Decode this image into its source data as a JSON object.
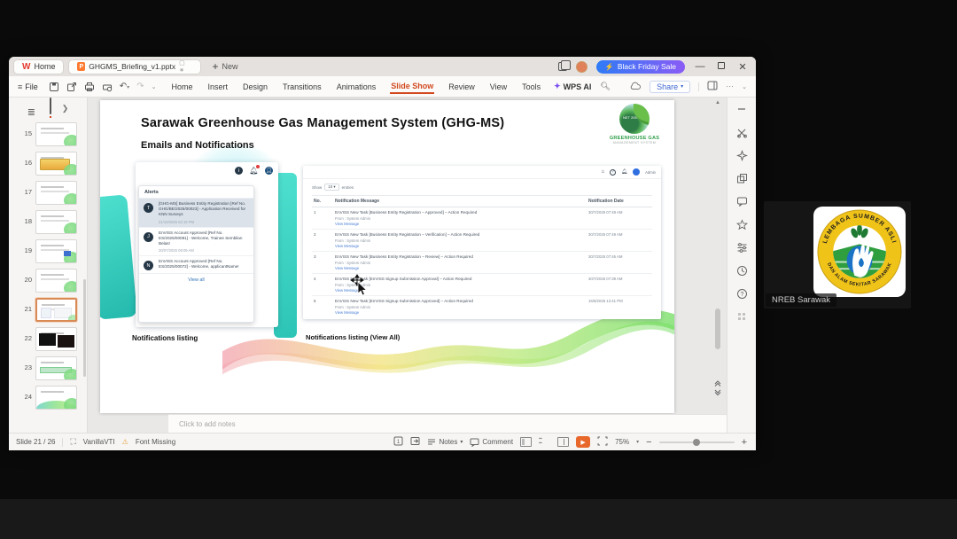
{
  "window": {
    "titlebar": {
      "home_tab": "Home",
      "doc_tab": "GHGMS_Briefing_v1.pptx",
      "new_tab": "New",
      "sale_button": "Black Friday Sale"
    },
    "ribbon": {
      "file": "File",
      "menus": [
        "Home",
        "Insert",
        "Design",
        "Transitions",
        "Animations",
        "Slide Show",
        "Review",
        "View",
        "Tools"
      ],
      "active_menu": "Slide Show",
      "wps_ai": "WPS AI",
      "share": "Share"
    }
  },
  "sidebar": {
    "slides": [
      "15",
      "16",
      "17",
      "18",
      "19",
      "20",
      "21",
      "22",
      "23",
      "24"
    ],
    "selected": "21"
  },
  "slide": {
    "title": "Sarawak Greenhouse Gas Management System (GHG-MS)",
    "subtitle": "Emails and Notifications",
    "logo": {
      "name": "GREENHOUSE GAS",
      "tagline": "MANAGEMENT SYSTEM",
      "badge": "NET 2050"
    },
    "alerts": {
      "header": "Alerts",
      "items": [
        {
          "initial": "T",
          "text": "[GHG-MS] Business Entity Registration [Ref No. GHG/BE/2025/00023] - Application Received for KNN Surveys",
          "date": "21/10/2025 02:19 PM"
        },
        {
          "initial": "J",
          "text": "EnVISS Account Approved [Ref No. ES/2025/00081] - Welcome, Trainee Sembilan Belas!",
          "date": "30/07/2025 09:09 AM"
        },
        {
          "initial": "N",
          "text": "EnVISS Account Approved [Ref No. ES/2025/00072] - Welcome, applicantName!",
          "date": ""
        }
      ],
      "view_all": "View all"
    },
    "table": {
      "show_label": "Show",
      "show_value": "10",
      "entries_label": "entries",
      "user_name": "Admin",
      "headers": {
        "no": "No.",
        "message": "Notification Message",
        "date": "Notification Date"
      },
      "rows": [
        {
          "no": "1",
          "message": "EnVISS New Task [Business Entity Registration – Approved] – Action Required",
          "from": "From : System Admin",
          "link": "View Message",
          "date": "30/7/2025 07:49 AM"
        },
        {
          "no": "2",
          "message": "EnVISS New Task [Business Entity Registration – Verification] – Action Required",
          "from": "From : System Admin",
          "link": "View Message",
          "date": "30/7/2025 07:49 AM"
        },
        {
          "no": "3",
          "message": "EnVISS New Task [Business Entity Registration – Review] – Action Required",
          "from": "From : System Admin",
          "link": "View Message",
          "date": "30/7/2025 07:46 AM"
        },
        {
          "no": "4",
          "message": "EnVISS New Task [EnVISS Signup Submission Approval] – Action Required",
          "from": "From : System Admin",
          "link": "View Message",
          "date": "30/7/2025 07:39 AM"
        },
        {
          "no": "5",
          "message": "EnVISS New Task [EnVISS Signup Submission Approved] – Action Required",
          "from": "From : System Admin",
          "link": "View Message",
          "date": "16/6/2025 12:41 PM"
        }
      ]
    },
    "captions": {
      "left": "Notifications listing",
      "right": "Notifications listing (View All)"
    }
  },
  "notes": {
    "placeholder": "Click to add notes"
  },
  "statusbar": {
    "slide_info": "Slide 21 / 26",
    "language": "VanillaVTI",
    "warning": "Font Missing",
    "notes_button": "Notes",
    "comment_button": "Comment",
    "zoom_level": "75%"
  },
  "participant": {
    "name": "NREB Sarawak",
    "logo_arc_top": "LEMBAGA SUMBER ASLI",
    "logo_arc_bottom": "DAN ALAM SEKITAR SARAWAK"
  },
  "colors": {
    "accent_orange": "#d2491f",
    "link_blue": "#4a7fd4",
    "teal": "#3fd0c2",
    "sale_gradient_start": "#2f7bf6",
    "sale_gradient_end": "#8a5cf6"
  }
}
